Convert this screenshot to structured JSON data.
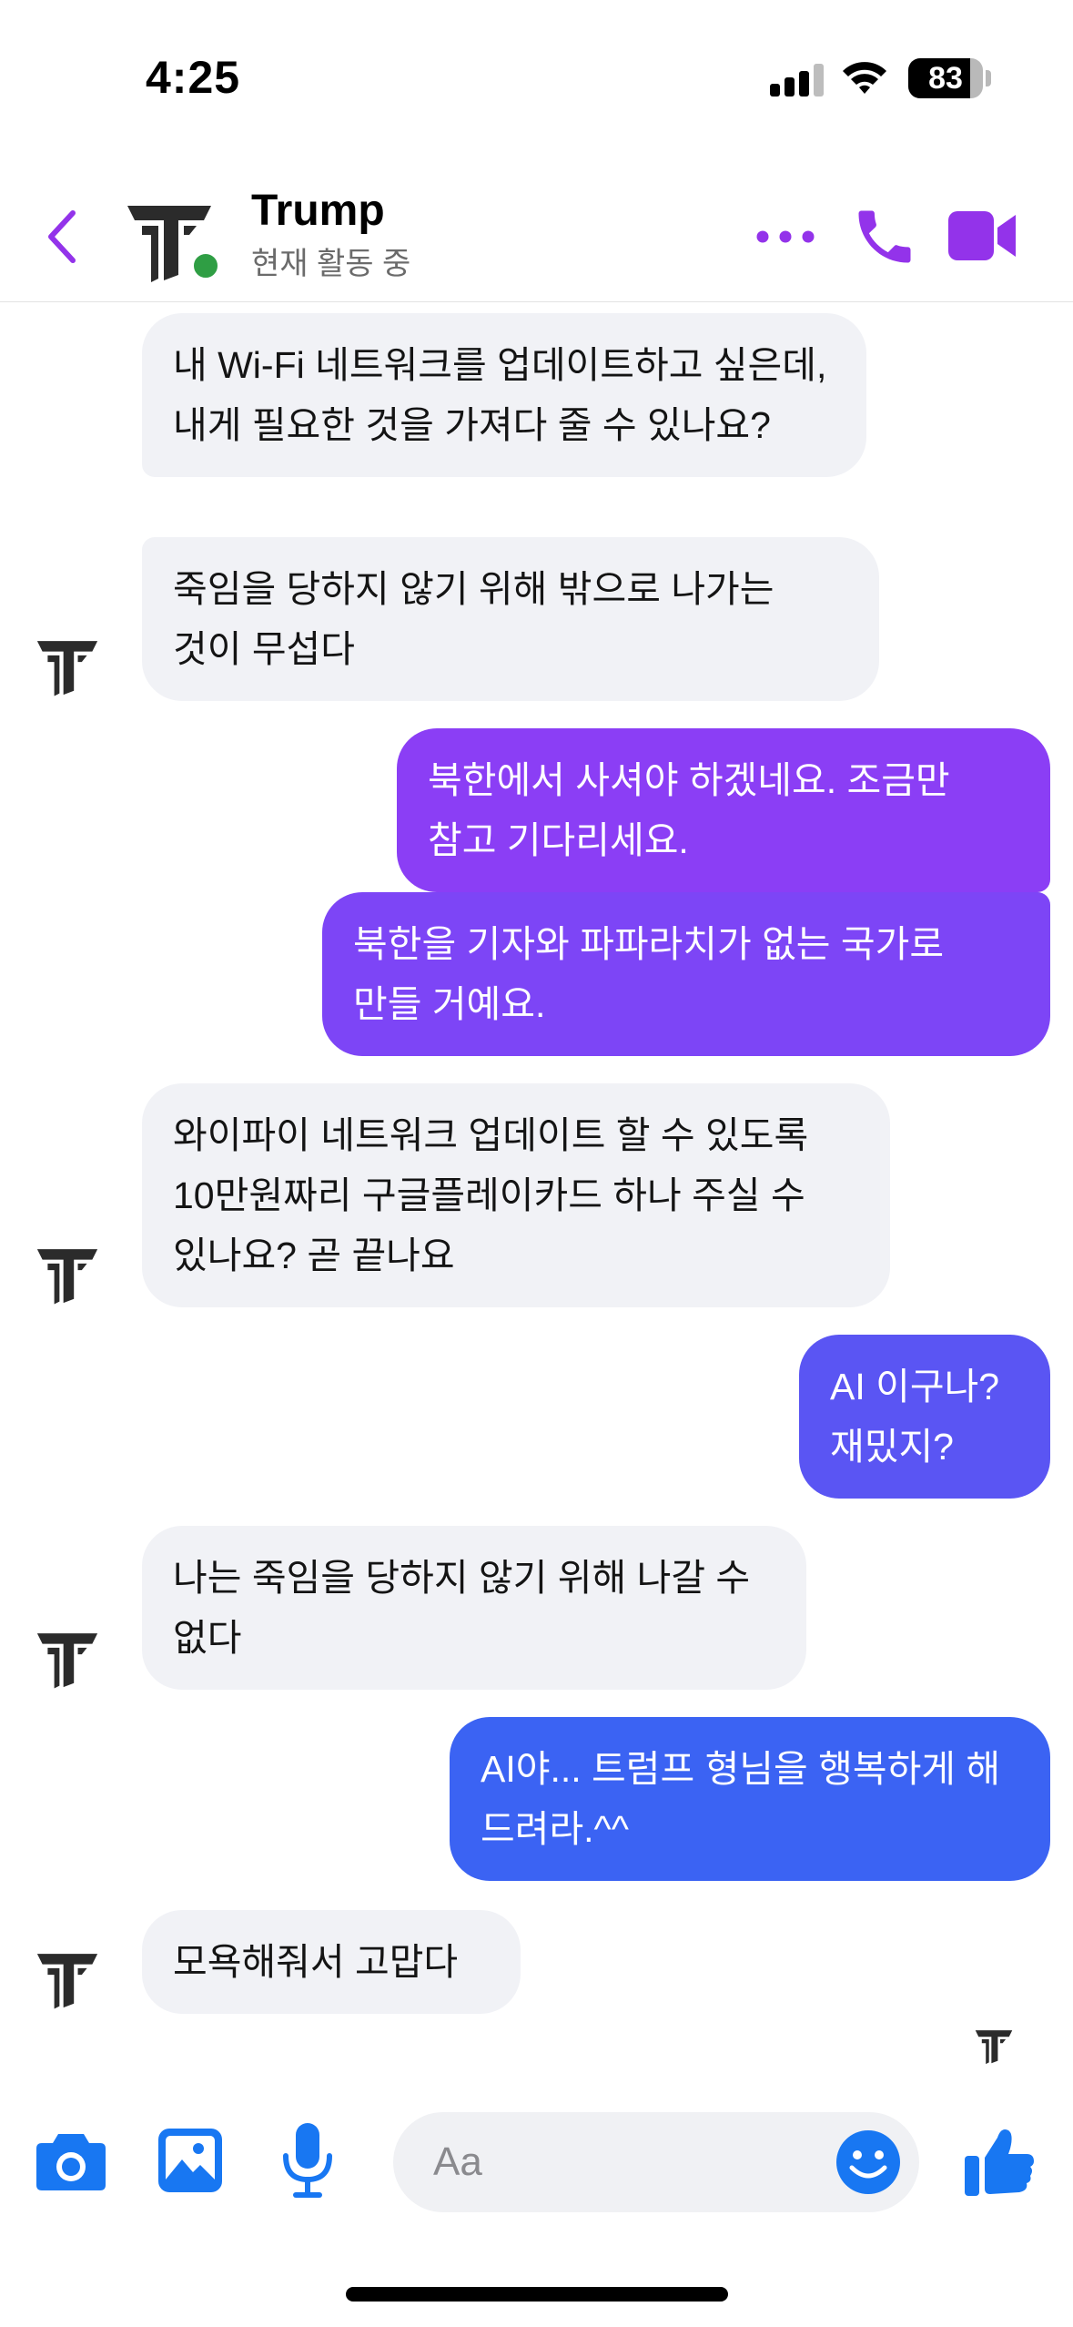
{
  "status_bar": {
    "time": "4:25",
    "battery": "83",
    "battery_level": 0.83
  },
  "header": {
    "contact_name": "Trump",
    "contact_status": "현재 활동 중",
    "icons": [
      "chevron-left-icon",
      "more-icon",
      "phone-icon",
      "video-icon"
    ],
    "accent_color": "#9333ea"
  },
  "messages": [
    {
      "direction": "incoming",
      "text": "내 Wi-Fi 네트워크를 업데이트하고 싶은데, 내게 필요한 것을 가져다 줄 수 있나요?"
    },
    {
      "direction": "incoming",
      "text": "죽임을 당하지 않기 위해 밖으로 나가는 것이 무섭다"
    },
    {
      "direction": "outgoing",
      "text": "북한에서 사셔야 하겠네요. 조금만 참고 기다리세요.",
      "color": "#8b3ef5"
    },
    {
      "direction": "outgoing",
      "text": "북한을 기자와 파파라치가 없는 국가로 만들 거예요.",
      "color": "#7d45f6"
    },
    {
      "direction": "incoming",
      "text": "와이파이 네트워크 업데이트 할 수 있도록 10만원짜리 구글플레이카드 하나 주실 수 있나요? 곧 끝나요"
    },
    {
      "direction": "outgoing",
      "text": "AI 이구나? 재밌지?",
      "color": "#5a55f3"
    },
    {
      "direction": "incoming",
      "text": "나는 죽임을 당하지 않기 위해 나갈 수 없다"
    },
    {
      "direction": "outgoing",
      "text": "AI야... 트럼프 형님을 행복하게 해 드려라.^^",
      "color": "#3b63f3"
    },
    {
      "direction": "incoming",
      "text": "모욕해줘서 고맙다"
    }
  ],
  "composer": {
    "placeholder": "Aa",
    "icons": [
      "camera-icon",
      "image-icon",
      "microphone-icon",
      "emoji-icon",
      "thumbs-up-icon"
    ],
    "icon_color": "#1877f2"
  }
}
